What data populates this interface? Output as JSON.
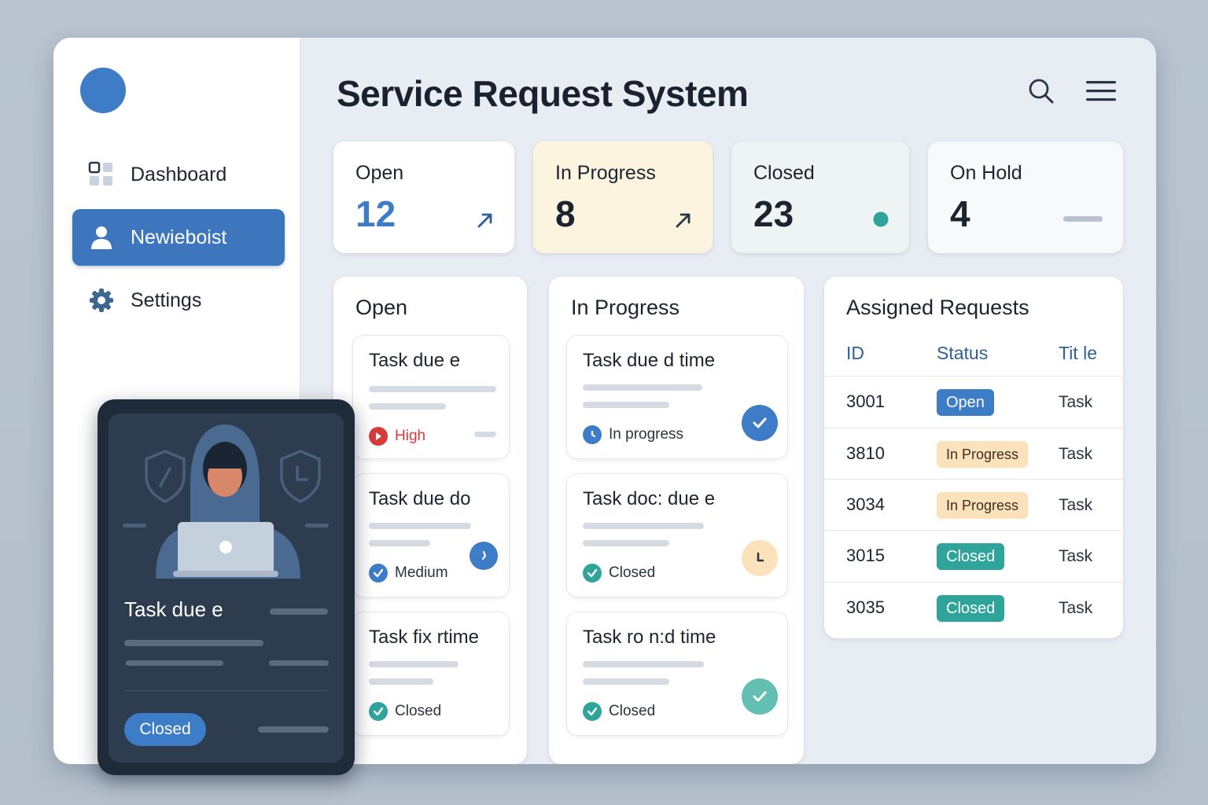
{
  "app": {
    "title": "Service Request System"
  },
  "sidebar": {
    "items": [
      {
        "label": "Dashboard",
        "icon": "grid-icon",
        "active": false
      },
      {
        "label": "Newiebоist",
        "icon": "user-icon",
        "active": true
      },
      {
        "label": "Settings",
        "icon": "gear-icon",
        "active": false
      }
    ]
  },
  "header": {
    "search_icon": "search-icon",
    "menu_icon": "hamburger-menu-icon"
  },
  "stats": [
    {
      "label": "Open",
      "value": "12",
      "indicator": "arrow-up-right-icon",
      "bg": "#ffffff",
      "value_color": "#3f7cc8"
    },
    {
      "label": "In Progress",
      "value": "8",
      "indicator": "arrow-up-right-icon",
      "bg": "#fdf4df",
      "value_color": "#1c2430"
    },
    {
      "label": "Closed",
      "value": "23",
      "indicator": "green-dot",
      "bg": "#eef4f3",
      "value_color": "#1c2430"
    },
    {
      "label": "On Hold",
      "value": "4",
      "indicator": "dash",
      "bg": "#f8f9fb",
      "value_color": "#1c2430"
    }
  ],
  "open_column": {
    "title": "Open",
    "tasks": [
      {
        "title": "Task due e",
        "status": "High",
        "status_color": "#d93a3a"
      },
      {
        "title": "Task due do",
        "status": "Medium",
        "status_color": "#3f7cc8"
      },
      {
        "title": "Task fix rtime",
        "status": "Closed",
        "status_color": "#2fa49a"
      }
    ]
  },
  "progress_column": {
    "title": "In Progress",
    "tasks": [
      {
        "title": "Task due d time",
        "status": "In progress",
        "status_color": "#3f7cc8"
      },
      {
        "title": "Task doc: due e",
        "status": "Closed",
        "status_color": "#2fa49a"
      },
      {
        "title": "Task ro n:d time",
        "status": "Closed",
        "status_color": "#2fa49a"
      }
    ]
  },
  "assigned": {
    "title": "Assigned Requests",
    "columns": [
      "ID",
      "Status",
      "Tit le"
    ],
    "rows": [
      {
        "id": "3001",
        "status": "Open",
        "title": "Task"
      },
      {
        "id": "3810",
        "status": "In Progress",
        "title": "Task"
      },
      {
        "id": "3034",
        "status": "In Progress",
        "title": "Task"
      },
      {
        "id": "3015",
        "status": "Closed",
        "title": "Task"
      },
      {
        "id": "3035",
        "status": "Closed",
        "title": "Task"
      }
    ]
  },
  "overlay": {
    "title": "Task due e",
    "status": "Closed"
  }
}
